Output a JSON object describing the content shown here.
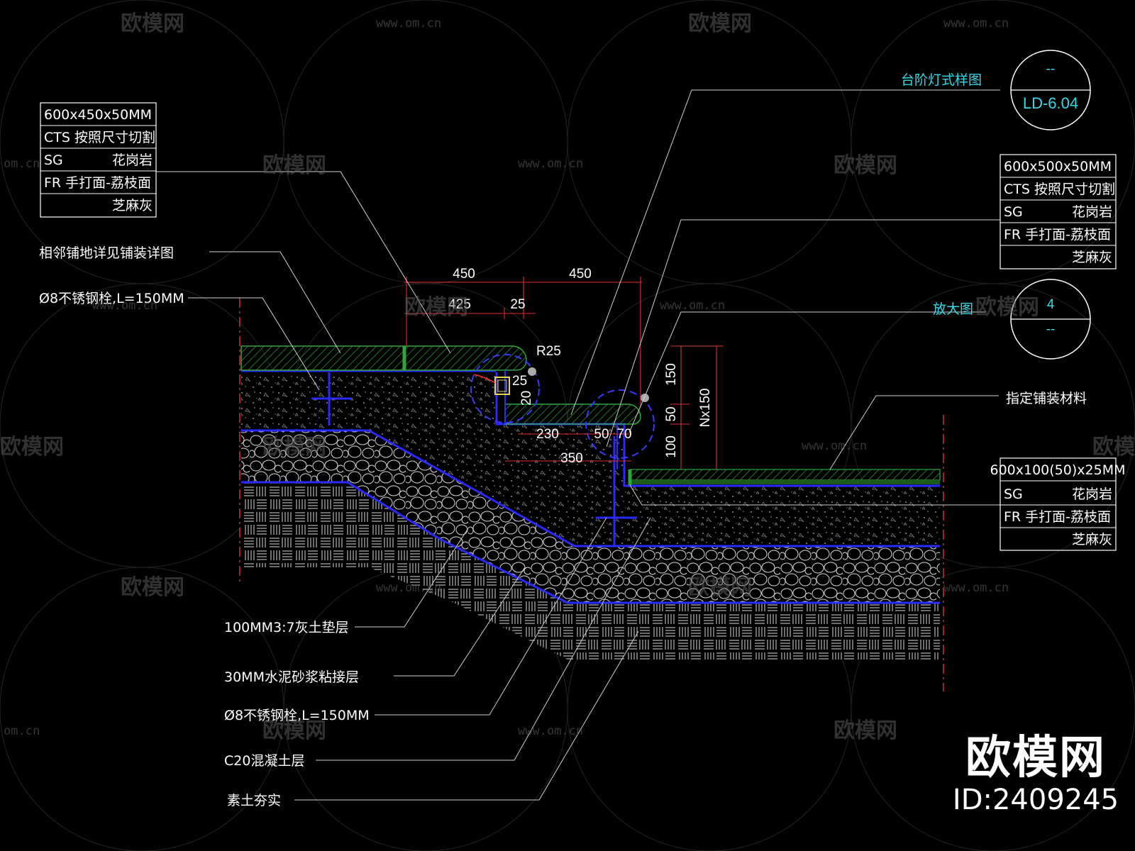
{
  "watermark": {
    "brand": "欧模网",
    "url": "www.om.cn",
    "url_fragment": "om.cn",
    "brand_fragment": "欧模网"
  },
  "stamp": {
    "name": "欧模网",
    "id": "ID:2409245"
  },
  "ref_callouts": {
    "lamp_title": "台阶灯式样图",
    "lamp_top": "--",
    "lamp_bottom": "LD-6.04",
    "zoom_title": "放大图",
    "zoom_top": "4",
    "zoom_bottom": "--"
  },
  "spec_table_left": [
    "600x450x50MM",
    "CTS 按照尺寸切割",
    "SG",
    "花岗岩",
    "FR 手打面-荔枝面",
    "芝麻灰"
  ],
  "spec_table_right_top": [
    "600x500x50MM",
    "CTS 按照尺寸切割",
    "SG",
    "花岗岩",
    "FR 手打面-荔枝面",
    "芝麻灰"
  ],
  "spec_table_right_bottom": [
    "600x100(50)x25MM",
    "SG",
    "花岗岩",
    "FR 手打面-荔枝面",
    "芝麻灰"
  ],
  "notes": {
    "adjacent_paving": "相邻铺地详见铺装详图",
    "bolt_top": "Ø8不锈钢栓,L=150MM",
    "specified_material": "指定铺装材料",
    "lime_soil": "100MM3:7灰土垫层",
    "mortar": "30MM水泥砂浆粘接层",
    "bolt_bottom": "Ø8不锈钢栓,L=150MM",
    "concrete": "C20混凝土层",
    "compacted_soil": "素土夯实"
  },
  "dimensions": {
    "d450a": "450",
    "d450b": "450",
    "d425": "425",
    "d25a": "25",
    "r25": "R25",
    "d25b": "25",
    "d20": "20",
    "d230": "230",
    "d50a": "50",
    "d70": "70",
    "d350": "350",
    "d150": "150",
    "d50b": "50",
    "d100": "100",
    "dNx150": "Nx150"
  }
}
